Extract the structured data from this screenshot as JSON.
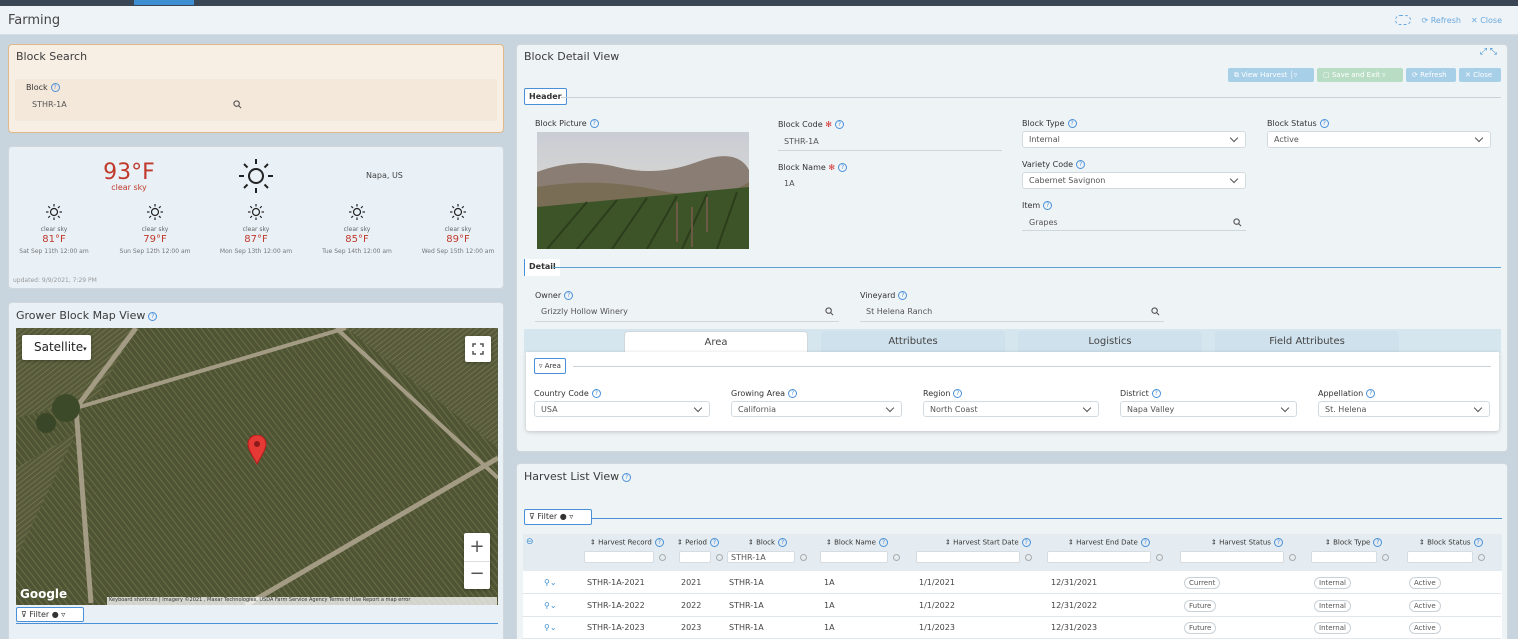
{
  "app": {
    "title": "Farming",
    "refresh_label": "Refresh",
    "close_label": "Close"
  },
  "block_search": {
    "title": "Block Search",
    "block_label": "Block",
    "block_value": "STHR-1A"
  },
  "weather": {
    "current_temp": "93°F",
    "current_cond": "clear sky",
    "location": "Napa, US",
    "updated": "updated: 9/9/2021, 7:29 PM",
    "forecast": [
      {
        "cond": "clear sky",
        "temp": "81°F",
        "date": "Sat Sep 11th 12:00 am"
      },
      {
        "cond": "clear sky",
        "temp": "79°F",
        "date": "Sun Sep 12th 12:00 am"
      },
      {
        "cond": "clear sky",
        "temp": "87°F",
        "date": "Mon Sep 13th 12:00 am"
      },
      {
        "cond": "clear sky",
        "temp": "85°F",
        "date": "Tue Sep 14th 12:00 am"
      },
      {
        "cond": "clear sky",
        "temp": "89°F",
        "date": "Wed Sep 15th 12:00 am"
      }
    ]
  },
  "map": {
    "title": "Grower Block Map View",
    "map_type": "Satellite",
    "google": "Google",
    "attribution": "Keyboard shortcuts | Imagery ©2021 , Maxar Technologies, USDA Farm Service Agency  Terms of Use  Report a map error",
    "filter_label": "Filter"
  },
  "detail": {
    "title": "Block Detail View",
    "buttons": {
      "view_harvest": "View Harvest",
      "save_exit": "Save and Exit",
      "refresh": "Refresh",
      "close": "Close"
    },
    "header_label": "Header",
    "detail_label": "Detail",
    "block_picture_label": "Block Picture",
    "block_code_label": "Block Code",
    "block_code": "STHR-1A",
    "block_name_label": "Block Name",
    "block_name": "1A",
    "block_type_label": "Block Type",
    "block_type": "Internal",
    "block_status_label": "Block Status",
    "block_status": "Active",
    "variety_code_label": "Variety Code",
    "variety_code": "Cabernet Savignon",
    "item_label": "Item",
    "item": "Grapes",
    "owner_label": "Owner",
    "owner": "Grizzly Hollow Winery",
    "vineyard_label": "Vineyard",
    "vineyard": "St Helena Ranch",
    "tabs": [
      "Area",
      "Attributes",
      "Logistics",
      "Field Attributes"
    ],
    "area_group": "Area",
    "country_label": "Country Code",
    "country": "USA",
    "growing_area_label": "Growing Area",
    "growing_area": "California",
    "region_label": "Region",
    "region": "North Coast",
    "district_label": "District",
    "district": "Napa Valley",
    "appellation_label": "Appellation",
    "appellation": "St. Helena"
  },
  "harvest": {
    "title": "Harvest List View",
    "filter_label": "Filter",
    "headers": [
      "Harvest Record",
      "Period",
      "Block",
      "Block Name",
      "Harvest Start Date",
      "Harvest End Date",
      "Harvest Status",
      "Block Type",
      "Block Status"
    ],
    "block_filter": "STHR-1A",
    "rows": [
      {
        "record": "STHR-1A-2021",
        "period": "2021",
        "block": "STHR-1A",
        "name": "1A",
        "start": "1/1/2021",
        "end": "12/31/2021",
        "status": "Current",
        "type": "Internal",
        "bstatus": "Active"
      },
      {
        "record": "STHR-1A-2022",
        "period": "2022",
        "block": "STHR-1A",
        "name": "1A",
        "start": "1/1/2022",
        "end": "12/31/2022",
        "status": "Future",
        "type": "Internal",
        "bstatus": "Active"
      },
      {
        "record": "STHR-1A-2023",
        "period": "2023",
        "block": "STHR-1A",
        "name": "1A",
        "start": "1/1/2023",
        "end": "12/31/2023",
        "status": "Future",
        "type": "Internal",
        "bstatus": "Active"
      }
    ]
  },
  "colors": {
    "accent": "#3d8fd1",
    "temp_red": "#c0392b",
    "search_bg": "#f7efe6",
    "search_border": "#e0b98a"
  }
}
